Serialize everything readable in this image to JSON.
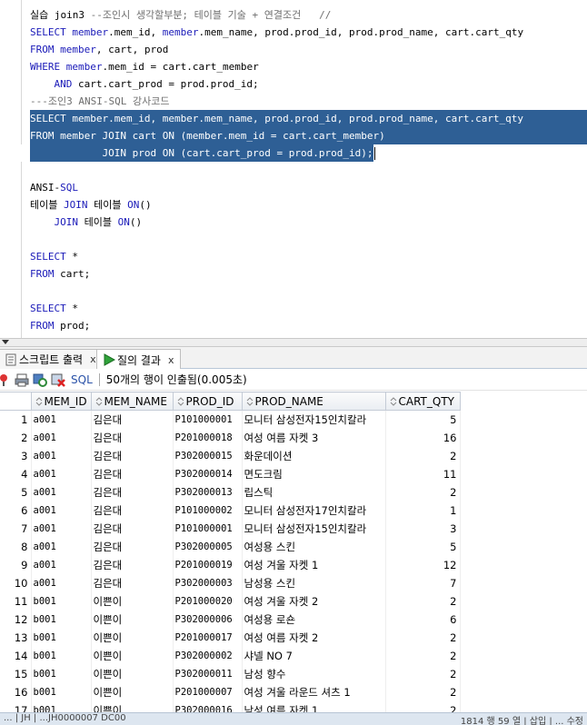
{
  "editor": {
    "lines": [
      [
        {
          "t": "실습 join3 ",
          "c": "pl"
        },
        {
          "t": "--조인시 생각할부분; 테이블 기술 + 연결조건   //",
          "c": "cm"
        }
      ],
      [
        {
          "t": "SELECT ",
          "c": "kw"
        },
        {
          "t": "member",
          "c": "kw"
        },
        {
          "t": ".mem_id, ",
          "c": "pl"
        },
        {
          "t": "member",
          "c": "kw"
        },
        {
          "t": ".mem_name, prod.prod_id, prod.prod_name, cart.cart_qty",
          "c": "pl"
        }
      ],
      [
        {
          "t": "FROM ",
          "c": "kw"
        },
        {
          "t": "member",
          "c": "kw"
        },
        {
          "t": ", cart, prod",
          "c": "pl"
        }
      ],
      [
        {
          "t": "WHERE ",
          "c": "kw"
        },
        {
          "t": "member",
          "c": "kw"
        },
        {
          "t": ".mem_id = cart.cart_member",
          "c": "pl"
        }
      ],
      [
        {
          "t": "    AND ",
          "c": "kw"
        },
        {
          "t": "cart.cart_prod = prod.prod_id;",
          "c": "pl"
        }
      ],
      [
        {
          "t": "---조인3 ANSI-SQL 강사코드",
          "c": "cm"
        }
      ],
      [
        {
          "t": "SELECT member.mem_id, member.mem_name, prod.prod_id, prod.prod_name, cart.cart_qty",
          "c": "pl",
          "sel": "full"
        }
      ],
      [
        {
          "t": "FROM member JOIN cart ON (member.mem_id = cart.cart_member)",
          "c": "pl",
          "sel": "full"
        }
      ],
      [
        {
          "t": "            JOIN prod ON (cart.cart_prod = prod.prod_id);",
          "c": "pl",
          "sel": "part"
        }
      ],
      [],
      [
        {
          "t": "ANSI-",
          "c": "pl"
        },
        {
          "t": "SQL",
          "c": "kw"
        }
      ],
      [
        {
          "t": "테이블 ",
          "c": "pl"
        },
        {
          "t": "JOIN",
          "c": "kw"
        },
        {
          "t": " 테이블 ",
          "c": "pl"
        },
        {
          "t": "ON",
          "c": "kw"
        },
        {
          "t": "()",
          "c": "pl"
        }
      ],
      [
        {
          "t": "    ",
          "c": "pl"
        },
        {
          "t": "JOIN",
          "c": "kw"
        },
        {
          "t": " 테이블 ",
          "c": "pl"
        },
        {
          "t": "ON",
          "c": "kw"
        },
        {
          "t": "()",
          "c": "pl"
        }
      ],
      [],
      [
        {
          "t": "SELECT ",
          "c": "kw"
        },
        {
          "t": "*",
          "c": "pl"
        }
      ],
      [
        {
          "t": "FROM ",
          "c": "kw"
        },
        {
          "t": "cart;",
          "c": "pl"
        }
      ],
      [],
      [
        {
          "t": "SELECT ",
          "c": "kw"
        },
        {
          "t": "*",
          "c": "pl"
        }
      ],
      [
        {
          "t": "FROM ",
          "c": "kw"
        },
        {
          "t": "prod;",
          "c": "pl"
        }
      ]
    ]
  },
  "tabs": [
    {
      "label": "스크립트 출력",
      "close": "x"
    },
    {
      "label": "질의 결과",
      "close": "x"
    }
  ],
  "toolbar": {
    "sql_label": "SQL",
    "status": "50개의 행이 인출됨(0.005초)"
  },
  "grid": {
    "columns": [
      "MEM_ID",
      "MEM_NAME",
      "PROD_ID",
      "PROD_NAME",
      "CART_QTY"
    ],
    "rows": [
      [
        "1",
        "a001",
        "김은대",
        "P101000001",
        "모니터 삼성전자15인치칼라",
        "5"
      ],
      [
        "2",
        "a001",
        "김은대",
        "P201000018",
        "여성 여름 자켓 3",
        "16"
      ],
      [
        "3",
        "a001",
        "김은대",
        "P302000015",
        "화운데이션",
        "2"
      ],
      [
        "4",
        "a001",
        "김은대",
        "P302000014",
        "면도크림",
        "11"
      ],
      [
        "5",
        "a001",
        "김은대",
        "P302000013",
        "립스틱",
        "2"
      ],
      [
        "6",
        "a001",
        "김은대",
        "P101000002",
        "모니터 삼성전자17인치칼라",
        "1"
      ],
      [
        "7",
        "a001",
        "김은대",
        "P101000001",
        "모니터 삼성전자15인치칼라",
        "3"
      ],
      [
        "8",
        "a001",
        "김은대",
        "P302000005",
        "여성용 스킨",
        "5"
      ],
      [
        "9",
        "a001",
        "김은대",
        "P201000019",
        "여성 겨울 자켓 1",
        "12"
      ],
      [
        "10",
        "a001",
        "김은대",
        "P302000003",
        "남성용 스킨",
        "7"
      ],
      [
        "11",
        "b001",
        "이쁜이",
        "P201000020",
        "여성 겨울 자켓 2",
        "2"
      ],
      [
        "12",
        "b001",
        "이쁜이",
        "P302000006",
        "여성용 로숀",
        "6"
      ],
      [
        "13",
        "b001",
        "이쁜이",
        "P201000017",
        "여성 여름 자켓 2",
        "2"
      ],
      [
        "14",
        "b001",
        "이쁜이",
        "P302000002",
        "샤넬 NO 7",
        "2"
      ],
      [
        "15",
        "b001",
        "이쁜이",
        "P302000011",
        "남성 향수",
        "2"
      ],
      [
        "16",
        "b001",
        "이쁜이",
        "P201000007",
        "여성 겨울 라운드 셔츠 1",
        "2"
      ],
      [
        "17",
        "b001",
        "이쁜이",
        "P302000016",
        "남성 여름 자켓 1",
        "2"
      ]
    ]
  },
  "statusbar": {
    "left": "... | JH | ...JH0000007 DC00",
    "right": "1814 행 59 열 | 삽입 | ... 수정"
  },
  "colors": {
    "keyword": "#1a1ab8",
    "comment": "#6e6e6e",
    "selection": "#2e5f95",
    "current_line": "#fffbe0"
  }
}
